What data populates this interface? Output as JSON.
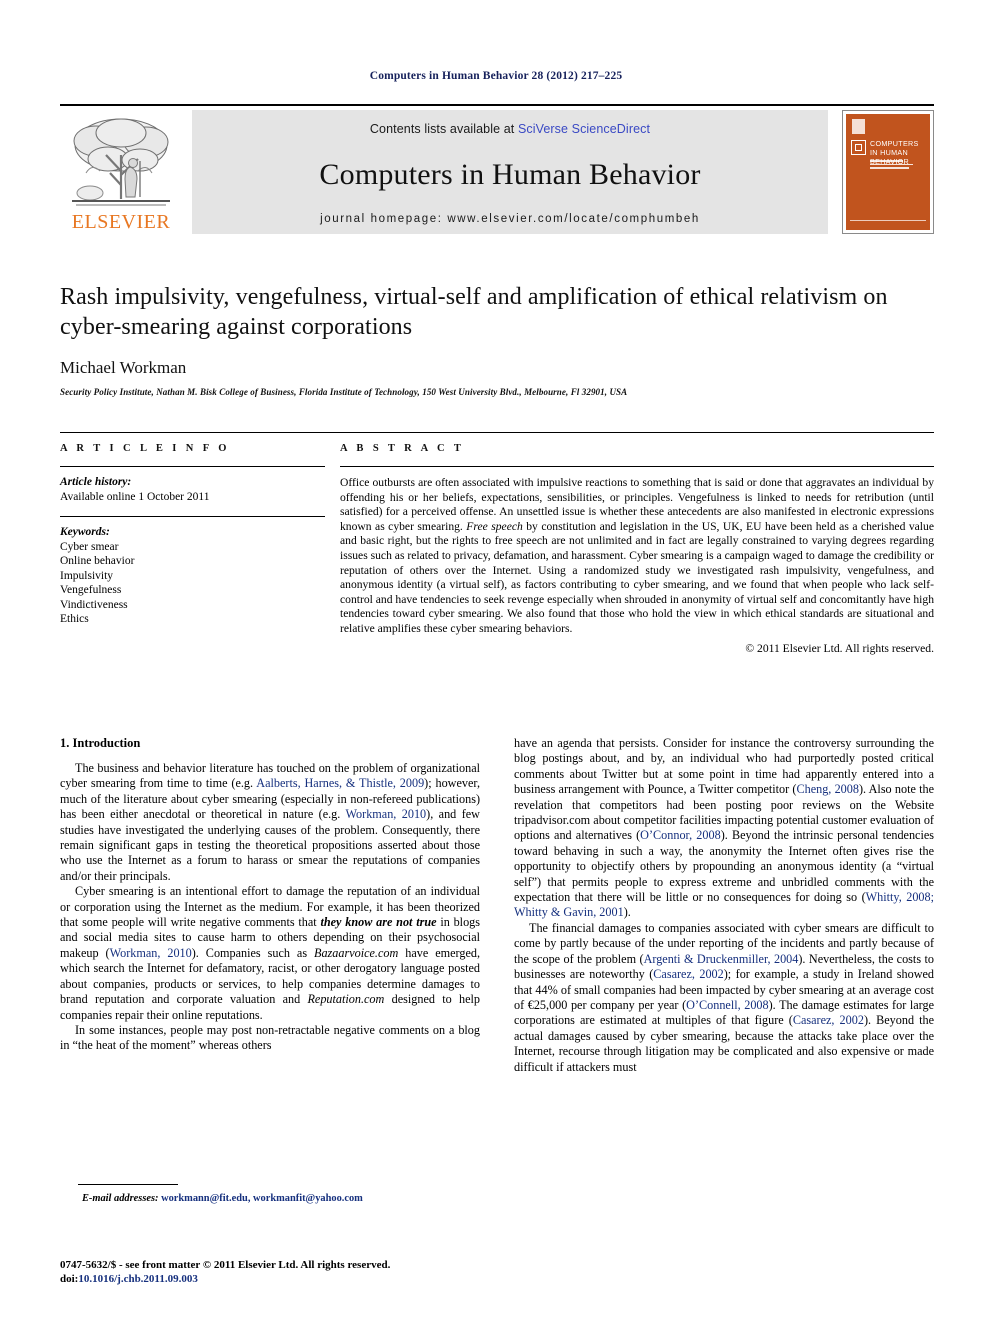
{
  "running_head": "Computers in Human Behavior 28 (2012) 217–225",
  "banner": {
    "publisher_name": "ELSEVIER",
    "contents_prefix": "Contents lists available at ",
    "contents_link": "SciVerse ScienceDirect",
    "journal_title": "Computers in Human Behavior",
    "homepage": "journal homepage: www.elsevier.com/locate/comphumbeh",
    "cover_title": "COMPUTERS IN HUMAN BEHAVIOR",
    "cover_color": "#C1541E",
    "link_color": "#3a49c4",
    "brand_orange": "#E87722"
  },
  "article": {
    "title": "Rash impulsivity, vengefulness, virtual-self and amplification of ethical relativism on cyber-smearing against corporations",
    "author": "Michael Workman",
    "affiliation": "Security Policy Institute, Nathan M. Bisk College of Business, Florida Institute of Technology, 150 West University Blvd., Melbourne, Fl 32901, USA"
  },
  "article_info": {
    "heading": "A R T I C L E   I N F O",
    "history_label": "Article history:",
    "history_value": "Available online 1 October 2011",
    "keywords_label": "Keywords:",
    "keywords": [
      "Cyber smear",
      "Online behavior",
      "Impulsivity",
      "Vengefulness",
      "Vindictiveness",
      "Ethics"
    ]
  },
  "abstract": {
    "heading": "A B S T R A C T",
    "part1": "Office outbursts are often associated with impulsive reactions to something that is said or done that aggravates an individual by offending his or her beliefs, expectations, sensibilities, or principles. Vengefulness is linked to needs for retribution (until satisfied) for a perceived offense. An unsettled issue is whether these antecedents are also manifested in electronic expressions known as cyber smearing. ",
    "italic1": "Free speech",
    "part2": " by constitution and legislation in the US, UK, EU have been held as a cherished value and basic right, but the rights to free speech are not unlimited and in fact are legally constrained to varying degrees regarding issues such as related to privacy, defamation, and harassment. Cyber smearing is a campaign waged to damage the credibility or reputation of others over the Internet. Using a randomized study we investigated rash impulsivity, vengefulness, and anonymous identity (a virtual self), as factors contributing to cyber smearing, and we found that when people who lack self-control and have tendencies to seek revenge especially when shrouded in anonymity of virtual self and concomitantly have high tendencies toward cyber smearing. We also found that those who hold the view in which ethical standards are situational and relative amplifies these cyber smearing behaviors.",
    "copyright": "© 2011 Elsevier Ltd. All rights reserved."
  },
  "body": {
    "section_title": "1. Introduction",
    "left": {
      "p1_a": "The business and behavior literature has touched on the problem of organizational cyber smearing from time to time (e.g. ",
      "p1_cite1": "Aalberts, Harnes, & Thistle, 2009",
      "p1_b": "); however, much of the literature about cyber smearing (especially in non-refereed publications) has been either anecdotal or theoretical in nature (e.g. ",
      "p1_cite2": "Workman, 2010",
      "p1_c": "), and few studies have investigated the underlying causes of the problem. Consequently, there remain significant gaps in testing the theoretical propositions asserted about those who use the Internet as a forum to harass or smear the reputations of companies and/or their principals.",
      "p2_a": "Cyber smearing is an intentional effort to damage the reputation of an individual or corporation using the Internet as the medium. For example, it has been theorized that some people will write negative comments that ",
      "p2_bolditalic": "they know are not true",
      "p2_b": " in blogs and social media sites to cause harm to others depending on their psychosocial makeup (",
      "p2_cite1": "Workman, 2010",
      "p2_c": "). Companies such as ",
      "p2_italic1": "Bazaarvoice.com",
      "p2_d": " have emerged, which search the Internet for defamatory, racist, or other derogatory language posted about companies, products or services, to help companies determine damages to brand reputation and corporate valuation and ",
      "p2_italic2": "Reputation.com",
      "p2_e": " designed to help companies repair their online reputations.",
      "p3": "In some instances, people may post non-retractable negative comments on a blog in “the heat of the moment” whereas others"
    },
    "right": {
      "p1_a": "have an agenda that persists. Consider for instance the controversy surrounding the blog postings about, and by, an individual who had purportedly posted critical comments about Twitter but at some point in time had apparently entered into a business arrangement with Pounce, a Twitter competitor (",
      "p1_cite1": "Cheng, 2008",
      "p1_b": "). Also note the revelation that competitors had been posting poor reviews on the Website tripadvisor.com about competitor facilities impacting potential customer evaluation of options and alternatives (",
      "p1_cite2": "O’Connor, 2008",
      "p1_c": "). Beyond the intrinsic personal tendencies toward behaving in such a way, the anonymity the Internet often gives rise the opportunity to objectify others by propounding an anonymous identity (a “virtual self”) that permits people to express extreme and unbridled comments with the expectation that there will be little or no consequences for doing so (",
      "p1_cite3": "Whitty, 2008; Whitty & Gavin, 2001",
      "p1_d": ").",
      "p2_a": "The financial damages to companies associated with cyber smears are difficult to come by partly because of the under reporting of the incidents and partly because of the scope of the problem (",
      "p2_cite1": "Argenti & Druckenmiller, 2004",
      "p2_b": "). Nevertheless, the costs to businesses are noteworthy (",
      "p2_cite2": "Casarez, 2002",
      "p2_c": "); for example, a study in Ireland showed that 44% of small companies had been impacted by cyber smearing at an average cost of €25,000 per company per year (",
      "p2_cite3": "O’Connell, 2008",
      "p2_d": "). The damage estimates for large corporations are estimated at multiples of that figure (",
      "p2_cite4": "Casarez, 2002",
      "p2_e": "). Beyond the actual damages caused by cyber smearing, because the attacks take place over the Internet, recourse through litigation may be complicated and also expensive or made difficult if attackers must"
    }
  },
  "footnote": {
    "label": "E-mail addresses:",
    "emails": " workmann@fit.edu, workmanfit@yahoo.com"
  },
  "colophon": {
    "issn_line": "0747-5632/$ - see front matter © 2011 Elsevier Ltd. All rights reserved.",
    "doi_label": "doi:",
    "doi_value": "10.1016/j.chb.2011.09.003"
  }
}
